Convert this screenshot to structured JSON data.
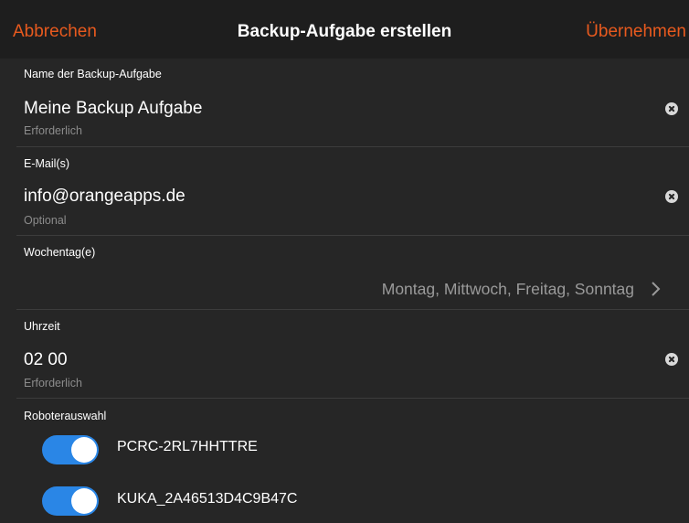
{
  "header": {
    "cancel_label": "Abbrechen",
    "title": "Backup-Aufgabe erstellen",
    "apply_label": "Übernehmen"
  },
  "form": {
    "name": {
      "label": "Name der Backup-Aufgabe",
      "value": "Meine Backup Aufgabe",
      "hint": "Erforderlich"
    },
    "email": {
      "label": "E-Mail(s)",
      "value": "info@orangeapps.de",
      "hint": "Optional"
    },
    "weekdays": {
      "label": "Wochentag(e)",
      "value": "Montag, Mittwoch, Freitag, Sonntag"
    },
    "time": {
      "label": "Uhrzeit",
      "value": "02 00",
      "hint": "Erforderlich"
    },
    "robots": {
      "label": "Roboterauswahl",
      "items": [
        {
          "name": "PCRC-2RL7HHTTRE",
          "enabled": true
        },
        {
          "name": "KUKA_2A46513D4C9B47C",
          "enabled": true
        }
      ]
    }
  },
  "icons": {
    "clear": "clear-circle-x-icon",
    "disclosure": "chevron-right-icon"
  },
  "colors": {
    "accent": "#e85a1e",
    "toggle_on": "#2a86e6",
    "background": "#262626",
    "header_background": "#1e1e1e"
  }
}
